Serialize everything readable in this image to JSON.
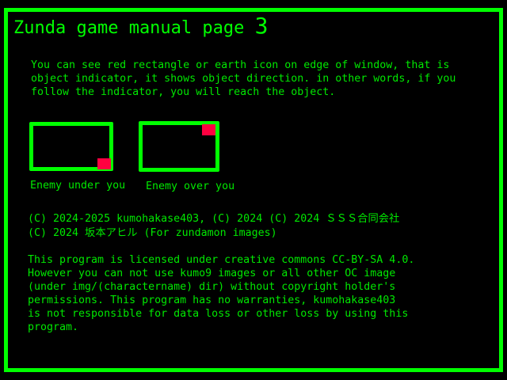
{
  "title": {
    "text": "Zunda game manual page",
    "page": "3"
  },
  "intro": [
    "You can see red rectangle or earth icon on edge of window, that is",
    "object indicator, it shows object direction. in other words, if you",
    "follow the indicator, you will reach the object."
  ],
  "examples": [
    {
      "label": "Enemy under you",
      "indicator_position": "bottom-right"
    },
    {
      "label": "Enemy over you",
      "indicator_position": "top-right"
    }
  ],
  "copyright": [
    "(C) 2024-2025 kumohakase403, (C) 2024 (C) 2024 ＳＳＳ合同会社",
    "(C) 2024 坂本アヒル (For zundamon images)"
  ],
  "license": [
    "This program is licensed under creative commons CC-BY-SA 4.0.",
    "However you can not use kumo9 images or all other OC image",
    "(under img/(charactername) dir) without copyright holder's",
    "permissions. This program has no warranties, kumohakase403",
    "is not responsible for data loss or other loss by using this",
    "program."
  ],
  "colors": {
    "border": "#00ff00",
    "text": "#00e800",
    "indicator": "#ff0040",
    "background": "#000000"
  }
}
